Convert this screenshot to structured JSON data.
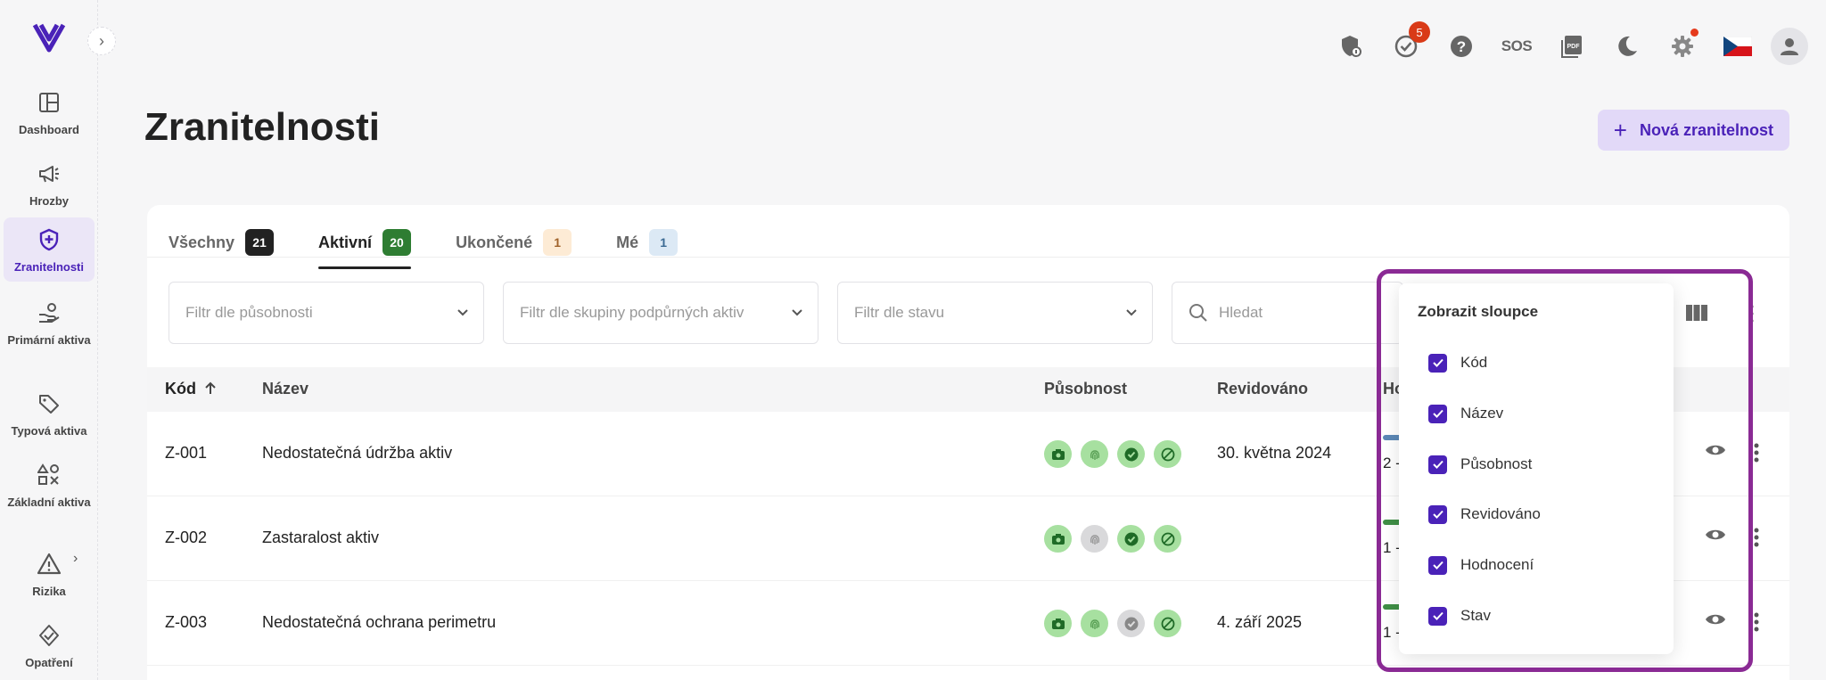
{
  "sidebar": {
    "items": [
      {
        "label": "Dashboard",
        "icon": "dashboard-icon"
      },
      {
        "label": "Hrozby",
        "icon": "megaphone-icon"
      },
      {
        "label": "Zranitelnosti",
        "icon": "shield-plus-icon"
      },
      {
        "label": "Primární aktiva",
        "icon": "hand-coins-icon"
      },
      {
        "label": "Typová aktiva",
        "icon": "tag-icon"
      },
      {
        "label": "Základní aktiva",
        "icon": "shapes-icon"
      },
      {
        "label": "Rizika",
        "icon": "warning-icon"
      },
      {
        "label": "Opatření",
        "icon": "shield-check-icon"
      }
    ]
  },
  "topbar": {
    "notifications_count": "5",
    "sos_label": "SOS"
  },
  "page": {
    "title": "Zranitelnosti",
    "new_button": "Nová zranitelnost"
  },
  "tabs": [
    {
      "label": "Všechny",
      "count": "21"
    },
    {
      "label": "Aktivní",
      "count": "20"
    },
    {
      "label": "Ukončené",
      "count": "1"
    },
    {
      "label": "Mé",
      "count": "1"
    }
  ],
  "filters": {
    "scope_placeholder": "Filtr dle působnosti",
    "asset_group_placeholder": "Filtr dle skupiny podpůrných aktiv",
    "state_placeholder": "Filtr dle stavu",
    "search_placeholder": "Hledat"
  },
  "table": {
    "columns": {
      "code": "Kód",
      "name": "Název",
      "scope": "Působnost",
      "revised": "Revidováno",
      "rating": "Ho"
    },
    "rows": [
      {
        "code": "Z-001",
        "name": "Nedostatečná údržba aktiv",
        "revised": "30. května 2024",
        "rating": "2 -"
      },
      {
        "code": "Z-002",
        "name": "Zastaralost aktiv",
        "revised": "",
        "rating": "1 -"
      },
      {
        "code": "Z-003",
        "name": "Nedostatečná ochrana perimetru",
        "revised": "4. září 2025",
        "rating": "1 -"
      }
    ]
  },
  "columns_menu": {
    "title": "Zobrazit sloupce",
    "items": [
      "Kód",
      "Název",
      "Působnost",
      "Revidováno",
      "Hodnocení",
      "Stav"
    ]
  },
  "colors": {
    "accent": "#4a22b8",
    "highlight": "#8a2a94"
  }
}
